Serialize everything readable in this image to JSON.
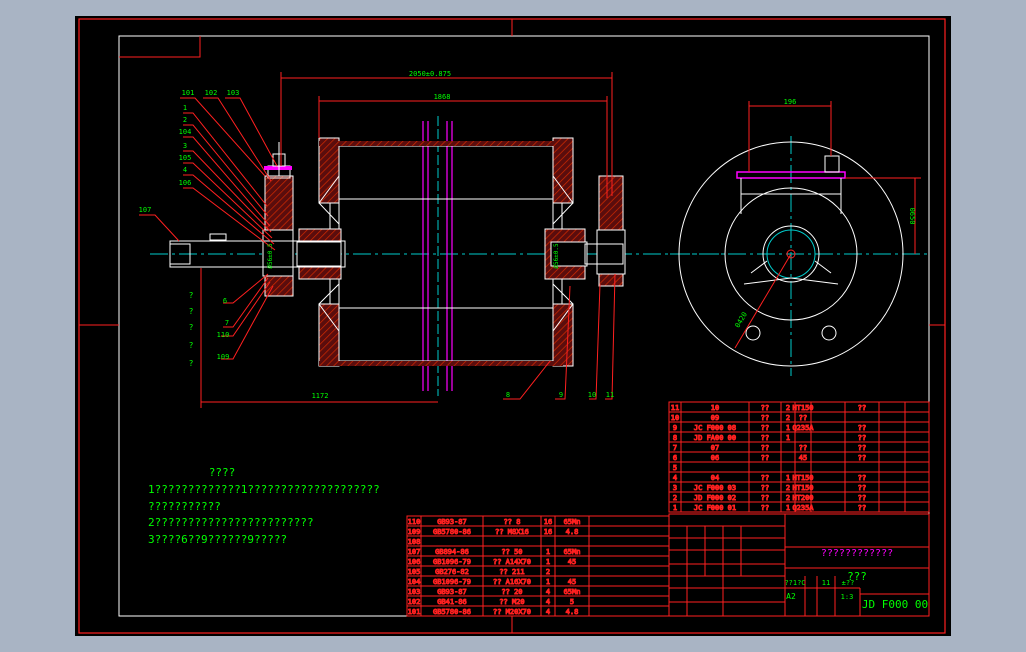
{
  "title_block": {
    "drawing_number": "JD F000 00",
    "name": "????????????",
    "company": "???",
    "sheet_size": "A2",
    "scale": "1:3",
    "material_label": "??1?C",
    "quantity_label": "11",
    "mass_label": "±??"
  },
  "leaders": {
    "left": [
      "101",
      "102",
      "103",
      "1",
      "2",
      "104",
      "3",
      "105",
      "4",
      "106",
      "107"
    ],
    "bottom": [
      "6",
      "7",
      "110",
      "109",
      "8",
      "9",
      "10",
      "11"
    ],
    "question_marks": [
      "?",
      "?",
      "?",
      "?",
      "?"
    ]
  },
  "dimensions": {
    "overall_width": "2050±0.875",
    "drum_width": "1868",
    "bottom_length": "1172",
    "side_width": "196",
    "side_height": "0650",
    "dia_label": "0420",
    "bearing_dia": "Ø56±0.5"
  },
  "notes": {
    "heading": "????",
    "lines": [
      "1?????????????1????????????????????",
      "???????????",
      "2????????????????????????",
      "3????6??9??????9?????"
    ]
  },
  "parts_right": [
    [
      "11",
      "10",
      "??",
      "2",
      "HT150",
      "",
      "??"
    ],
    [
      "10",
      "09",
      "??",
      "2",
      "??",
      "",
      ""
    ],
    [
      "9",
      "JC F000 08",
      "??",
      "1",
      "Q235A",
      "",
      "??"
    ],
    [
      "8",
      "JD FA00 00",
      "??",
      "1",
      "",
      "",
      "??"
    ],
    [
      "7",
      "07",
      "??",
      "",
      "??",
      "",
      "??"
    ],
    [
      "6",
      "06",
      "??",
      "",
      "45",
      "",
      "??"
    ],
    [
      "5",
      "",
      "",
      "",
      "",
      "",
      ""
    ],
    [
      "4",
      "04",
      "??",
      "1",
      "HT150",
      "",
      "??"
    ],
    [
      "3",
      "JC F000 03",
      "??",
      "2",
      "HT150",
      "",
      "??"
    ],
    [
      "2",
      "JD F000 02",
      "??",
      "2",
      "HT200",
      "",
      "??"
    ],
    [
      "1",
      "JC F000 01",
      "??",
      "1",
      "Q235A",
      "",
      "??"
    ]
  ],
  "parts_left": [
    [
      "110",
      "GB93-87",
      "?? 8",
      "16",
      "65Mn"
    ],
    [
      "109",
      "GB5780-86",
      "?? M8X16",
      "16",
      "4.8"
    ],
    [
      "108",
      "",
      "",
      "",
      ""
    ],
    [
      "107",
      "GB894-86",
      "?? 50",
      "1",
      "65Mn"
    ],
    [
      "106",
      "GB1096-79",
      "?? A14X70",
      "1",
      "45"
    ],
    [
      "105",
      "GB276-82",
      "?? 211",
      "2",
      ""
    ],
    [
      "104",
      "GB1096-79",
      "?? A16X70",
      "1",
      "45"
    ],
    [
      "103",
      "GB93-87",
      "?? 20",
      "4",
      "65Mn"
    ],
    [
      "102",
      "GB41-86",
      "?? M20",
      "4",
      "5"
    ],
    [
      "101",
      "GB5780-86",
      "?? M20X70",
      "4",
      "4.8"
    ]
  ],
  "colors": {
    "frame": "#ff0000",
    "text": "#00ff00",
    "outline": "#ffffff",
    "hatch": "#cc2200",
    "center": "#00cccc",
    "axis": "#ff00ff",
    "title": "#ff00ff"
  }
}
